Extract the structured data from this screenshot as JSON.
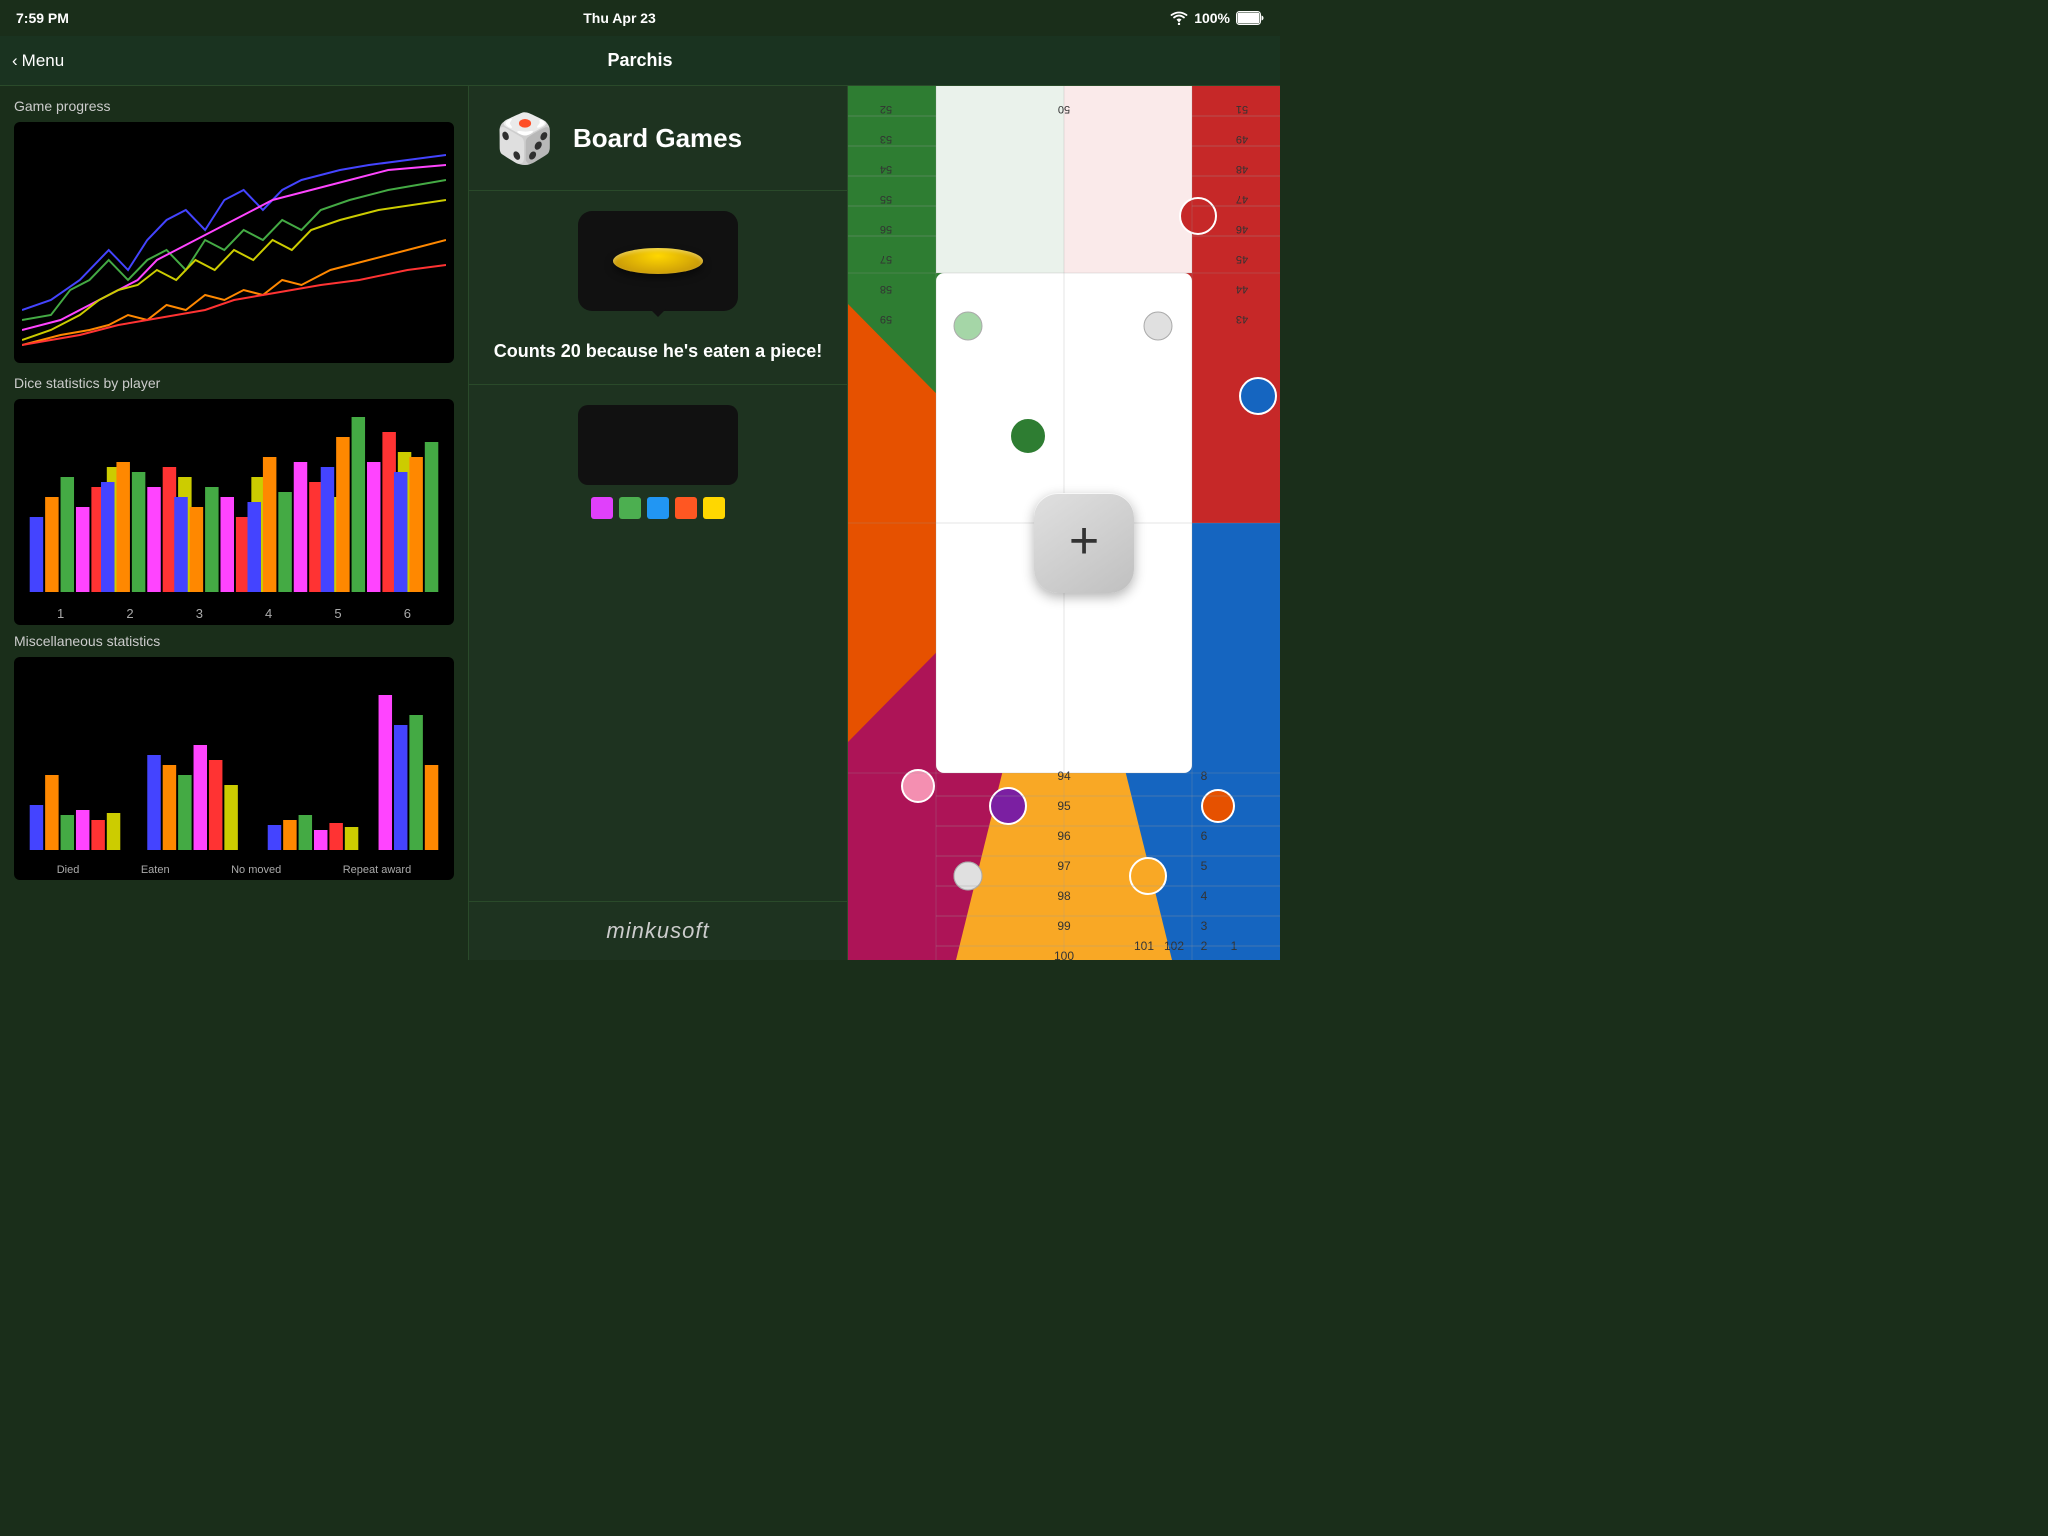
{
  "statusBar": {
    "time": "7:59 PM",
    "date": "Thu Apr 23",
    "wifi": "wifi-icon",
    "battery": "100%"
  },
  "navBar": {
    "backLabel": "Menu",
    "title": "Parchis"
  },
  "leftPanel": {
    "gameProgressTitle": "Game progress",
    "diceStatsTitle": "Dice statistics by player",
    "miscStatsTitle": "Miscellaneous statistics",
    "barLabels": [
      "1",
      "2",
      "3",
      "4",
      "5",
      "6"
    ],
    "miscLabels": [
      "Died",
      "Eaten",
      "No moved",
      "Repeat award"
    ]
  },
  "middlePanel": {
    "boardGamesTitle": "Board Games",
    "boardGamesIcon": "🎲",
    "tooltipText": "Counts 20 because he's eaten a piece!",
    "colorDots": [
      "#e040fb",
      "#4caf50",
      "#2196f3",
      "#ff5722",
      "#ffd700"
    ],
    "minkusoftLogo": "minkusoft"
  },
  "plusButton": {
    "symbol": "+"
  }
}
